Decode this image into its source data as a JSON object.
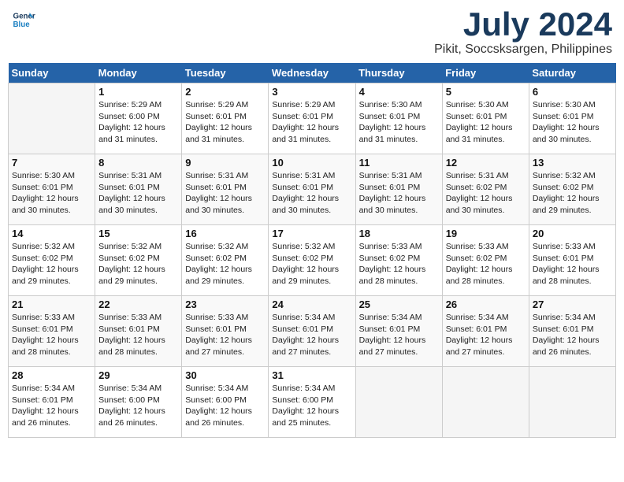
{
  "header": {
    "logo_line1": "General",
    "logo_line2": "Blue",
    "month_title": "July 2024",
    "location": "Pikit, Soccsksargen, Philippines"
  },
  "weekdays": [
    "Sunday",
    "Monday",
    "Tuesday",
    "Wednesday",
    "Thursday",
    "Friday",
    "Saturday"
  ],
  "weeks": [
    [
      {
        "day": "",
        "info": ""
      },
      {
        "day": "1",
        "info": "Sunrise: 5:29 AM\nSunset: 6:00 PM\nDaylight: 12 hours\nand 31 minutes."
      },
      {
        "day": "2",
        "info": "Sunrise: 5:29 AM\nSunset: 6:01 PM\nDaylight: 12 hours\nand 31 minutes."
      },
      {
        "day": "3",
        "info": "Sunrise: 5:29 AM\nSunset: 6:01 PM\nDaylight: 12 hours\nand 31 minutes."
      },
      {
        "day": "4",
        "info": "Sunrise: 5:30 AM\nSunset: 6:01 PM\nDaylight: 12 hours\nand 31 minutes."
      },
      {
        "day": "5",
        "info": "Sunrise: 5:30 AM\nSunset: 6:01 PM\nDaylight: 12 hours\nand 31 minutes."
      },
      {
        "day": "6",
        "info": "Sunrise: 5:30 AM\nSunset: 6:01 PM\nDaylight: 12 hours\nand 30 minutes."
      }
    ],
    [
      {
        "day": "7",
        "info": "Sunrise: 5:30 AM\nSunset: 6:01 PM\nDaylight: 12 hours\nand 30 minutes."
      },
      {
        "day": "8",
        "info": "Sunrise: 5:31 AM\nSunset: 6:01 PM\nDaylight: 12 hours\nand 30 minutes."
      },
      {
        "day": "9",
        "info": "Sunrise: 5:31 AM\nSunset: 6:01 PM\nDaylight: 12 hours\nand 30 minutes."
      },
      {
        "day": "10",
        "info": "Sunrise: 5:31 AM\nSunset: 6:01 PM\nDaylight: 12 hours\nand 30 minutes."
      },
      {
        "day": "11",
        "info": "Sunrise: 5:31 AM\nSunset: 6:01 PM\nDaylight: 12 hours\nand 30 minutes."
      },
      {
        "day": "12",
        "info": "Sunrise: 5:31 AM\nSunset: 6:02 PM\nDaylight: 12 hours\nand 30 minutes."
      },
      {
        "day": "13",
        "info": "Sunrise: 5:32 AM\nSunset: 6:02 PM\nDaylight: 12 hours\nand 29 minutes."
      }
    ],
    [
      {
        "day": "14",
        "info": "Sunrise: 5:32 AM\nSunset: 6:02 PM\nDaylight: 12 hours\nand 29 minutes."
      },
      {
        "day": "15",
        "info": "Sunrise: 5:32 AM\nSunset: 6:02 PM\nDaylight: 12 hours\nand 29 minutes."
      },
      {
        "day": "16",
        "info": "Sunrise: 5:32 AM\nSunset: 6:02 PM\nDaylight: 12 hours\nand 29 minutes."
      },
      {
        "day": "17",
        "info": "Sunrise: 5:32 AM\nSunset: 6:02 PM\nDaylight: 12 hours\nand 29 minutes."
      },
      {
        "day": "18",
        "info": "Sunrise: 5:33 AM\nSunset: 6:02 PM\nDaylight: 12 hours\nand 28 minutes."
      },
      {
        "day": "19",
        "info": "Sunrise: 5:33 AM\nSunset: 6:02 PM\nDaylight: 12 hours\nand 28 minutes."
      },
      {
        "day": "20",
        "info": "Sunrise: 5:33 AM\nSunset: 6:01 PM\nDaylight: 12 hours\nand 28 minutes."
      }
    ],
    [
      {
        "day": "21",
        "info": "Sunrise: 5:33 AM\nSunset: 6:01 PM\nDaylight: 12 hours\nand 28 minutes."
      },
      {
        "day": "22",
        "info": "Sunrise: 5:33 AM\nSunset: 6:01 PM\nDaylight: 12 hours\nand 28 minutes."
      },
      {
        "day": "23",
        "info": "Sunrise: 5:33 AM\nSunset: 6:01 PM\nDaylight: 12 hours\nand 27 minutes."
      },
      {
        "day": "24",
        "info": "Sunrise: 5:34 AM\nSunset: 6:01 PM\nDaylight: 12 hours\nand 27 minutes."
      },
      {
        "day": "25",
        "info": "Sunrise: 5:34 AM\nSunset: 6:01 PM\nDaylight: 12 hours\nand 27 minutes."
      },
      {
        "day": "26",
        "info": "Sunrise: 5:34 AM\nSunset: 6:01 PM\nDaylight: 12 hours\nand 27 minutes."
      },
      {
        "day": "27",
        "info": "Sunrise: 5:34 AM\nSunset: 6:01 PM\nDaylight: 12 hours\nand 26 minutes."
      }
    ],
    [
      {
        "day": "28",
        "info": "Sunrise: 5:34 AM\nSunset: 6:01 PM\nDaylight: 12 hours\nand 26 minutes."
      },
      {
        "day": "29",
        "info": "Sunrise: 5:34 AM\nSunset: 6:00 PM\nDaylight: 12 hours\nand 26 minutes."
      },
      {
        "day": "30",
        "info": "Sunrise: 5:34 AM\nSunset: 6:00 PM\nDaylight: 12 hours\nand 26 minutes."
      },
      {
        "day": "31",
        "info": "Sunrise: 5:34 AM\nSunset: 6:00 PM\nDaylight: 12 hours\nand 25 minutes."
      },
      {
        "day": "",
        "info": ""
      },
      {
        "day": "",
        "info": ""
      },
      {
        "day": "",
        "info": ""
      }
    ]
  ]
}
